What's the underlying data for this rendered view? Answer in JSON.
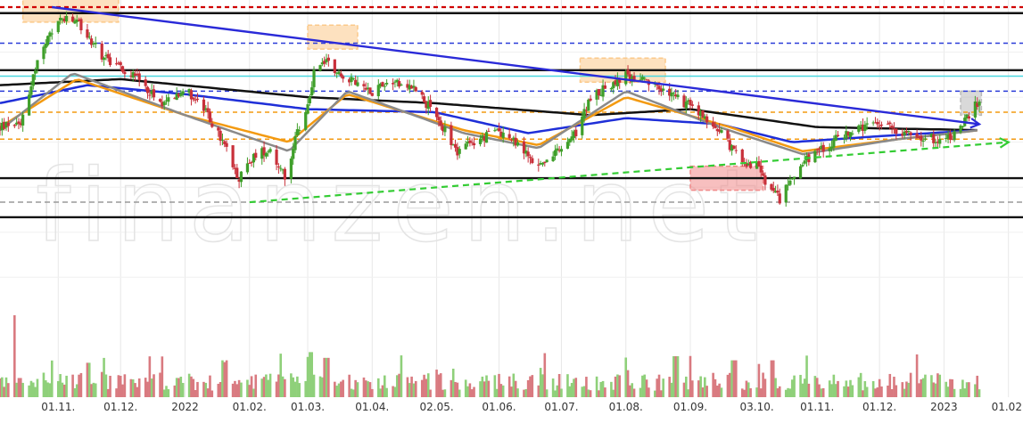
{
  "watermark": "finanzen.net",
  "colors": {
    "background": "#ffffff",
    "grid": "#e8e8e8",
    "up_candle": "#3f9f2a",
    "down_candle": "#c8303a",
    "vol_up": "#8fd07a",
    "vol_down": "#d97a80",
    "sma200": "#111111",
    "sma100": "#1f2fd8",
    "sma50": "#f39a11",
    "sma38": "#8a8a8a",
    "resistance_red": "#d00000",
    "level_black": "#111111",
    "level_blue": "#2a3bd8",
    "level_orange": "#f39a11",
    "level_gray": "#9a9a9a",
    "level_cyan": "#4ad8e0",
    "downtrend": "#2a2ad8",
    "uptrend": "#33cc33",
    "zone_orange": "#fbc98a",
    "zone_red": "#f08a8a",
    "zone_gray": "#b9b9b9"
  },
  "chart_data": {
    "type": "candlestick",
    "x_range": [
      "2021-10-04",
      "2023-02-08"
    ],
    "x_ticks": [
      "01.11.",
      "01.12.",
      "2022",
      "01.02.",
      "01.03.",
      "01.04.",
      "02.05.",
      "01.06.",
      "01.07.",
      "01.08.",
      "01.09.",
      "03.10.",
      "01.11.",
      "01.12.",
      "2023",
      "01.02."
    ],
    "x_tick_dates": [
      "2021-11-01",
      "2021-12-01",
      "2022-01-01",
      "2022-02-01",
      "2022-03-01",
      "2022-04-01",
      "2022-05-02",
      "2022-06-01",
      "2022-07-01",
      "2022-08-01",
      "2022-09-01",
      "2022-10-03",
      "2022-11-01",
      "2022-12-01",
      "2023-01-01",
      "2023-02-01"
    ],
    "y_range": [
      0,
      100
    ],
    "y_scale": "relative (no price axis printed)",
    "grid": true,
    "price_path": [
      [
        "2021-10-04",
        60
      ],
      [
        "2021-10-14",
        62
      ],
      [
        "2021-10-22",
        82
      ],
      [
        "2021-11-01",
        96
      ],
      [
        "2021-11-10",
        95
      ],
      [
        "2021-11-22",
        84
      ],
      [
        "2021-12-01",
        80
      ],
      [
        "2021-12-10",
        76
      ],
      [
        "2021-12-20",
        68
      ],
      [
        "2022-01-01",
        73
      ],
      [
        "2022-01-10",
        66
      ],
      [
        "2022-01-20",
        54
      ],
      [
        "2022-01-27",
        43
      ],
      [
        "2022-02-04",
        51
      ],
      [
        "2022-02-11",
        53
      ],
      [
        "2022-02-18",
        43
      ],
      [
        "2022-02-24",
        58
      ],
      [
        "2022-03-01",
        67
      ],
      [
        "2022-03-05",
        82
      ],
      [
        "2022-03-10",
        82
      ],
      [
        "2022-03-20",
        76
      ],
      [
        "2022-04-01",
        72
      ],
      [
        "2022-04-10",
        76
      ],
      [
        "2022-04-22",
        73
      ],
      [
        "2022-05-02",
        63
      ],
      [
        "2022-05-12",
        52
      ],
      [
        "2022-05-23",
        56
      ],
      [
        "2022-06-01",
        59
      ],
      [
        "2022-06-10",
        54
      ],
      [
        "2022-06-20",
        47
      ],
      [
        "2022-06-30",
        52
      ],
      [
        "2022-07-08",
        58
      ],
      [
        "2022-07-15",
        70
      ],
      [
        "2022-07-22",
        73
      ],
      [
        "2022-08-01",
        77
      ],
      [
        "2022-08-10",
        75
      ],
      [
        "2022-08-22",
        71
      ],
      [
        "2022-09-01",
        67
      ],
      [
        "2022-09-15",
        59
      ],
      [
        "2022-09-25",
        49
      ],
      [
        "2022-10-03",
        47
      ],
      [
        "2022-10-08",
        40
      ],
      [
        "2022-10-14",
        36
      ],
      [
        "2022-10-22",
        46
      ],
      [
        "2022-11-01",
        52
      ],
      [
        "2022-11-15",
        58
      ],
      [
        "2022-12-01",
        61
      ],
      [
        "2022-12-15",
        58
      ],
      [
        "2022-12-28",
        56
      ],
      [
        "2023-01-05",
        57
      ],
      [
        "2023-01-12",
        63
      ],
      [
        "2023-01-18",
        69
      ]
    ],
    "moving_averages": {
      "sma200": [
        [
          "2021-10-04",
          74
        ],
        [
          "2021-12-01",
          76
        ],
        [
          "2022-03-01",
          70
        ],
        [
          "2022-05-01",
          68
        ],
        [
          "2022-07-15",
          64
        ],
        [
          "2022-09-01",
          66
        ],
        [
          "2022-11-01",
          60
        ],
        [
          "2023-01-18",
          59
        ]
      ],
      "sma100": [
        [
          "2021-10-04",
          68
        ],
        [
          "2021-11-15",
          74
        ],
        [
          "2022-01-01",
          71
        ],
        [
          "2022-03-01",
          66
        ],
        [
          "2022-05-01",
          65
        ],
        [
          "2022-06-15",
          58
        ],
        [
          "2022-08-01",
          63
        ],
        [
          "2022-09-15",
          61
        ],
        [
          "2022-10-20",
          55
        ],
        [
          "2022-12-01",
          57
        ],
        [
          "2023-01-18",
          59
        ]
      ],
      "sma50": [
        [
          "2021-10-04",
          60
        ],
        [
          "2021-11-10",
          76
        ],
        [
          "2022-01-01",
          64
        ],
        [
          "2022-02-20",
          55
        ],
        [
          "2022-03-20",
          71
        ],
        [
          "2022-05-15",
          59
        ],
        [
          "2022-06-20",
          54
        ],
        [
          "2022-08-01",
          70
        ],
        [
          "2022-09-20",
          60
        ],
        [
          "2022-10-25",
          52
        ],
        [
          "2022-12-10",
          56
        ],
        [
          "2023-01-18",
          59
        ]
      ],
      "sma38": [
        [
          "2021-10-04",
          59
        ],
        [
          "2021-11-08",
          78
        ],
        [
          "2022-01-01",
          64
        ],
        [
          "2022-02-20",
          52
        ],
        [
          "2022-03-20",
          72
        ],
        [
          "2022-05-15",
          58
        ],
        [
          "2022-06-20",
          53
        ],
        [
          "2022-08-01",
          72
        ],
        [
          "2022-09-15",
          60
        ],
        [
          "2022-10-25",
          51
        ],
        [
          "2022-12-10",
          56
        ],
        [
          "2023-01-18",
          59
        ]
      ]
    },
    "horizontal_levels": [
      {
        "style": "dashed",
        "color": "#d00000",
        "y": 100
      },
      {
        "style": "solid",
        "color": "#111111",
        "y": 98
      },
      {
        "style": "dashed",
        "color": "#2a3bd8",
        "y": 88
      },
      {
        "style": "solid",
        "color": "#111111",
        "y": 79
      },
      {
        "style": "solid",
        "color": "#4ad8e0",
        "y": 77
      },
      {
        "style": "dashed",
        "color": "#2a3bd8",
        "y": 72
      },
      {
        "style": "dashed",
        "color": "#f39a11",
        "y": 65
      },
      {
        "style": "dashed",
        "color": "#f39a11",
        "y": 56
      },
      {
        "style": "solid",
        "color": "#111111",
        "y": 43
      },
      {
        "style": "dashed",
        "color": "#9a9a9a",
        "y": 35
      },
      {
        "style": "solid",
        "color": "#111111",
        "y": 30
      }
    ],
    "trendlines": [
      {
        "name": "downtrend",
        "style": "solid",
        "color": "#2a2ad8",
        "from": [
          "2021-10-29",
          100
        ],
        "to": [
          "2023-01-18",
          61
        ],
        "arrow": true
      },
      {
        "name": "uptrend",
        "style": "dashed",
        "color": "#33cc33",
        "from": [
          "2022-02-01",
          35
        ],
        "to": [
          "2023-02-01",
          55
        ],
        "arrow": true
      }
    ],
    "zones": [
      {
        "color": "#fbc98a",
        "x": [
          "2021-10-15",
          "2021-11-30"
        ],
        "y": [
          95,
          104
        ]
      },
      {
        "color": "#fbc98a",
        "x": [
          "2022-03-01",
          "2022-03-25"
        ],
        "y": [
          86,
          94
        ]
      },
      {
        "color": "#fbc98a",
        "x": [
          "2022-07-10",
          "2022-08-20"
        ],
        "y": [
          75,
          83
        ]
      },
      {
        "color": "#f08a8a",
        "x": [
          "2022-09-01",
          "2022-10-06"
        ],
        "y": [
          39,
          47
        ]
      },
      {
        "color": "#b9b9b9",
        "x": [
          "2023-01-09",
          "2023-01-19"
        ],
        "y": [
          64,
          72
        ]
      }
    ],
    "volume": {
      "y_range": [
        0,
        100
      ],
      "spikes": [
        [
          "2021-10-10",
          100
        ],
        [
          "2021-11-15",
          42
        ],
        [
          "2022-01-20",
          45
        ],
        [
          "2022-03-02",
          55
        ],
        [
          "2022-03-10",
          48
        ],
        [
          "2022-08-25",
          50
        ],
        [
          "2022-09-22",
          45
        ],
        [
          "2022-10-10",
          45
        ]
      ]
    }
  }
}
